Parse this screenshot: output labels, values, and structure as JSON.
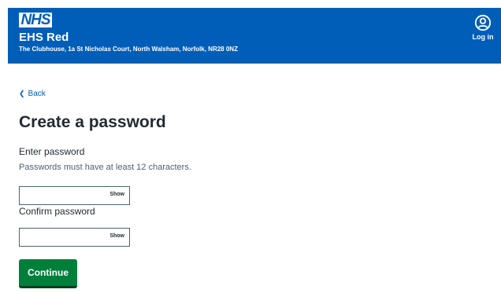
{
  "header": {
    "logo_text": "NHS",
    "org_name": "EHS Red",
    "org_address": "The Clubhouse, 1a St Nicholas Court, North Walsham, Norfolk, NR28 0NZ",
    "account_label": "Log in",
    "account_icon": "user-circle-icon"
  },
  "back": {
    "label": "Back",
    "icon": "chevron-left-icon"
  },
  "page_title": "Create a password",
  "password": {
    "label": "Enter password",
    "hint": "Passwords must have at least 12 characters.",
    "value": "",
    "show_label": "Show"
  },
  "confirm": {
    "label": "Confirm password",
    "value": "",
    "show_label": "Show"
  },
  "continue_label": "Continue",
  "colors": {
    "header_bg": "#005eb8",
    "link": "#005eb8",
    "button_bg": "#007f3b",
    "text": "#212b32"
  }
}
